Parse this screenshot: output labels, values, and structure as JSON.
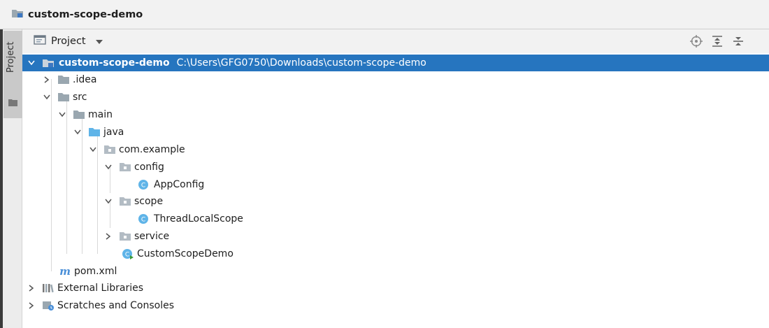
{
  "window": {
    "title": "custom-scope-demo"
  },
  "side_panel": {
    "tab_label": "Project"
  },
  "toolbar": {
    "view_label": "Project"
  },
  "tree": {
    "root": {
      "label": "custom-scope-demo",
      "path": "C:\\Users\\GFG0750\\Downloads\\custom-scope-demo"
    },
    "idea": ".idea",
    "src": "src",
    "main": "main",
    "java": "java",
    "com_example": "com.example",
    "config": "config",
    "app_config": "AppConfig",
    "scope": "scope",
    "thread_local_scope": "ThreadLocalScope",
    "service": "service",
    "custom_scope_demo": "CustomScopeDemo",
    "pom": "pom.xml",
    "external_libraries": "External Libraries",
    "scratches": "Scratches and Consoles"
  },
  "colors": {
    "selection": "#2675bf",
    "class_icon": "#5fb4e8",
    "folder": "#9aa7b0",
    "source_folder": "#5fb4e8"
  }
}
